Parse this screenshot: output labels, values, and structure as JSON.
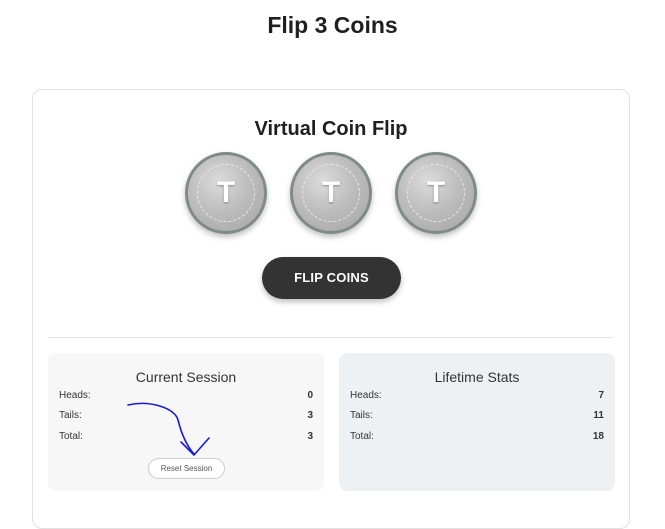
{
  "page": {
    "title": "Flip 3 Coins"
  },
  "card": {
    "title": "Virtual Coin Flip",
    "coins": [
      {
        "face": "T"
      },
      {
        "face": "T"
      },
      {
        "face": "T"
      }
    ],
    "flip_button_label": "FLIP COINS"
  },
  "current_session": {
    "title": "Current Session",
    "rows": [
      {
        "label": "Heads:",
        "value": "0"
      },
      {
        "label": "Tails:",
        "value": "3"
      },
      {
        "label": "Total:",
        "value": "3"
      }
    ],
    "reset_button_label": "Reset Session"
  },
  "lifetime_stats": {
    "title": "Lifetime Stats",
    "rows": [
      {
        "label": "Heads:",
        "value": "7"
      },
      {
        "label": "Tails:",
        "value": "11"
      },
      {
        "label": "Total:",
        "value": "18"
      }
    ]
  },
  "colors": {
    "button_dark": "#333333",
    "coin_rim": "#7f8b88",
    "annotation_ink": "#1a1adb"
  },
  "icons": {
    "annotation": "hand-drawn-arrow-icon"
  }
}
